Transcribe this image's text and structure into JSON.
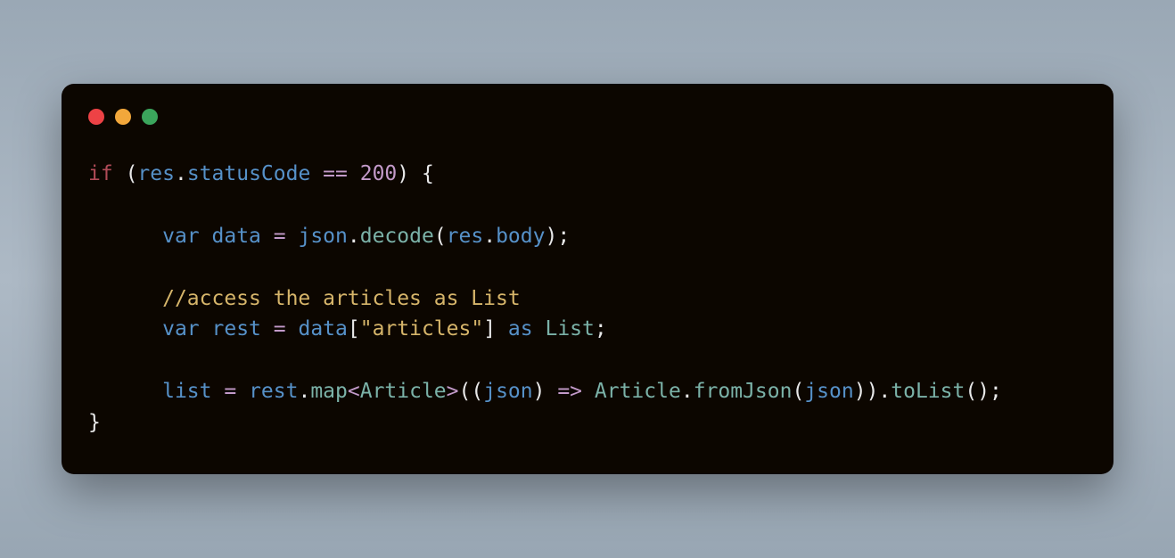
{
  "code": {
    "lines": [
      [
        {
          "cls": "tk-key",
          "t": "if"
        },
        {
          "cls": "tk-plain",
          "t": " "
        },
        {
          "cls": "tk-punc",
          "t": "("
        },
        {
          "cls": "tk-ident",
          "t": "res"
        },
        {
          "cls": "tk-punc",
          "t": "."
        },
        {
          "cls": "tk-prop",
          "t": "statusCode"
        },
        {
          "cls": "tk-plain",
          "t": " "
        },
        {
          "cls": "tk-op",
          "t": "=="
        },
        {
          "cls": "tk-plain",
          "t": " "
        },
        {
          "cls": "tk-num",
          "t": "200"
        },
        {
          "cls": "tk-punc",
          "t": ")"
        },
        {
          "cls": "tk-plain",
          "t": " "
        },
        {
          "cls": "tk-punc",
          "t": "{"
        }
      ],
      [],
      [
        {
          "cls": "tk-plain",
          "t": "      "
        },
        {
          "cls": "tk-var",
          "t": "var"
        },
        {
          "cls": "tk-plain",
          "t": " "
        },
        {
          "cls": "tk-ident",
          "t": "data"
        },
        {
          "cls": "tk-plain",
          "t": " "
        },
        {
          "cls": "tk-op",
          "t": "="
        },
        {
          "cls": "tk-plain",
          "t": " "
        },
        {
          "cls": "tk-ident",
          "t": "json"
        },
        {
          "cls": "tk-punc",
          "t": "."
        },
        {
          "cls": "tk-call",
          "t": "decode"
        },
        {
          "cls": "tk-punc",
          "t": "("
        },
        {
          "cls": "tk-ident",
          "t": "res"
        },
        {
          "cls": "tk-punc",
          "t": "."
        },
        {
          "cls": "tk-prop",
          "t": "body"
        },
        {
          "cls": "tk-punc",
          "t": ");"
        }
      ],
      [],
      [
        {
          "cls": "tk-plain",
          "t": "      "
        },
        {
          "cls": "tk-cmt",
          "t": "//access the articles as List"
        }
      ],
      [
        {
          "cls": "tk-plain",
          "t": "      "
        },
        {
          "cls": "tk-var",
          "t": "var"
        },
        {
          "cls": "tk-plain",
          "t": " "
        },
        {
          "cls": "tk-ident",
          "t": "rest"
        },
        {
          "cls": "tk-plain",
          "t": " "
        },
        {
          "cls": "tk-op",
          "t": "="
        },
        {
          "cls": "tk-plain",
          "t": " "
        },
        {
          "cls": "tk-ident",
          "t": "data"
        },
        {
          "cls": "tk-punc",
          "t": "["
        },
        {
          "cls": "tk-str",
          "t": "\"articles\""
        },
        {
          "cls": "tk-punc",
          "t": "]"
        },
        {
          "cls": "tk-plain",
          "t": " "
        },
        {
          "cls": "tk-var",
          "t": "as"
        },
        {
          "cls": "tk-plain",
          "t": " "
        },
        {
          "cls": "tk-type",
          "t": "List"
        },
        {
          "cls": "tk-punc",
          "t": ";"
        }
      ],
      [],
      [
        {
          "cls": "tk-plain",
          "t": "      "
        },
        {
          "cls": "tk-ident",
          "t": "list"
        },
        {
          "cls": "tk-plain",
          "t": " "
        },
        {
          "cls": "tk-op",
          "t": "="
        },
        {
          "cls": "tk-plain",
          "t": " "
        },
        {
          "cls": "tk-ident",
          "t": "rest"
        },
        {
          "cls": "tk-punc",
          "t": "."
        },
        {
          "cls": "tk-call",
          "t": "map"
        },
        {
          "cls": "tk-op",
          "t": "<"
        },
        {
          "cls": "tk-type",
          "t": "Article"
        },
        {
          "cls": "tk-op",
          "t": ">"
        },
        {
          "cls": "tk-punc",
          "t": "(("
        },
        {
          "cls": "tk-ident",
          "t": "json"
        },
        {
          "cls": "tk-punc",
          "t": ")"
        },
        {
          "cls": "tk-plain",
          "t": " "
        },
        {
          "cls": "tk-op",
          "t": "=>"
        },
        {
          "cls": "tk-plain",
          "t": " "
        },
        {
          "cls": "tk-type",
          "t": "Article"
        },
        {
          "cls": "tk-punc",
          "t": "."
        },
        {
          "cls": "tk-call",
          "t": "fromJson"
        },
        {
          "cls": "tk-punc",
          "t": "("
        },
        {
          "cls": "tk-ident",
          "t": "json"
        },
        {
          "cls": "tk-punc",
          "t": "))."
        },
        {
          "cls": "tk-call",
          "t": "toList"
        },
        {
          "cls": "tk-punc",
          "t": "();"
        }
      ],
      [
        {
          "cls": "tk-punc",
          "t": "}"
        }
      ]
    ]
  }
}
